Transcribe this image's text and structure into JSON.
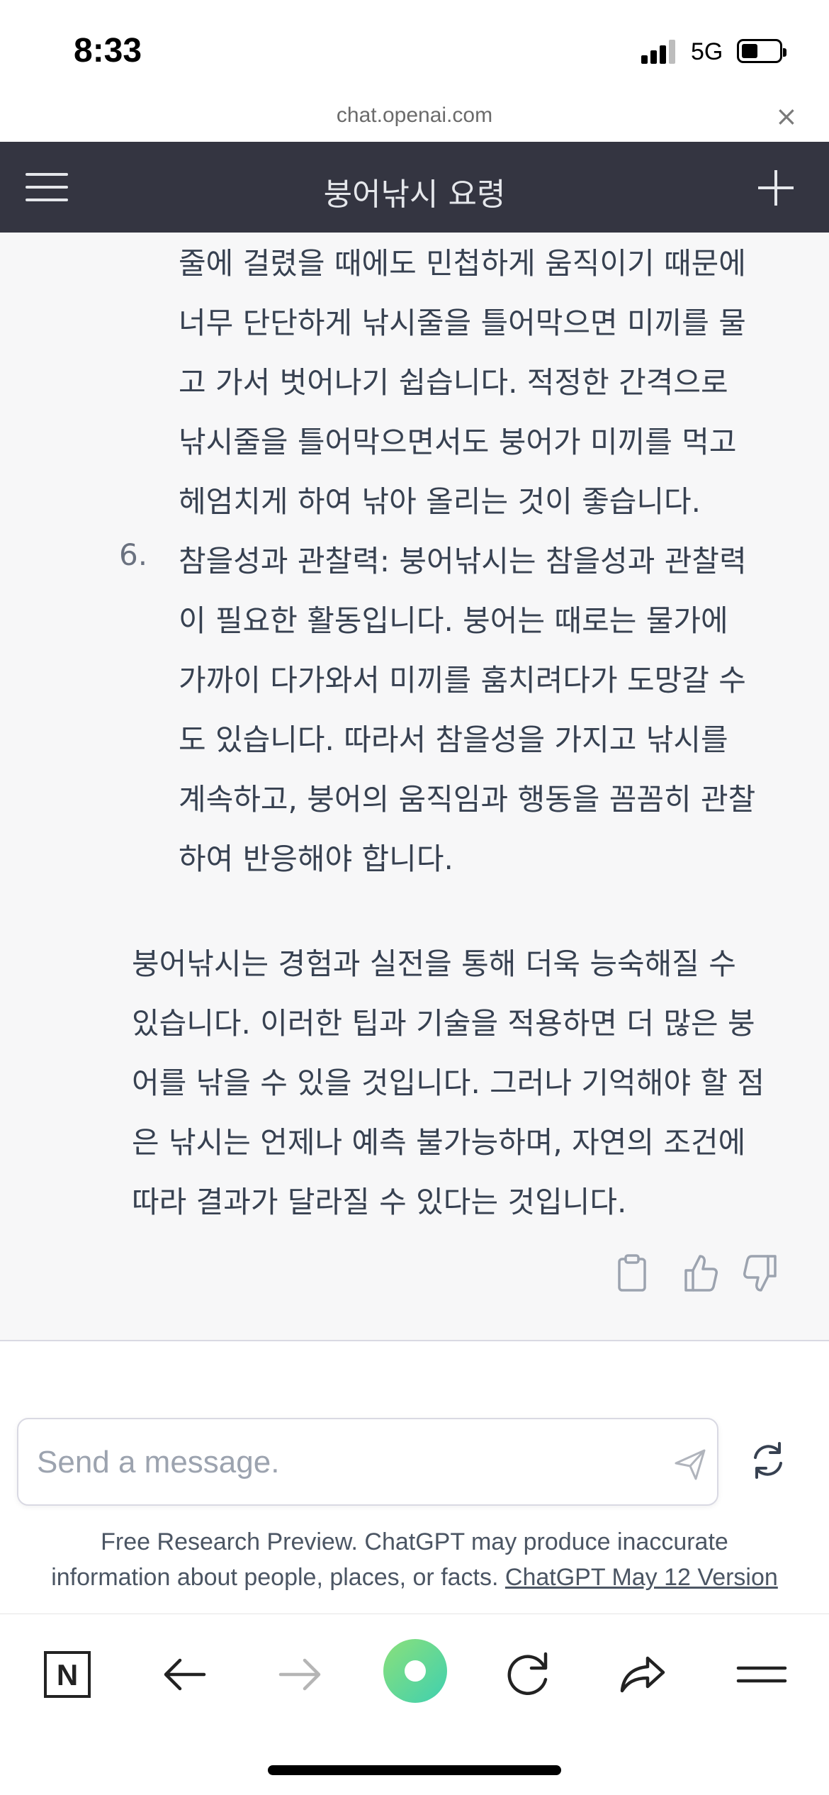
{
  "status_bar": {
    "time": "8:33",
    "network": "5G"
  },
  "browser": {
    "url": "chat.openai.com",
    "close_glyph": "×"
  },
  "header": {
    "menu_icon": "hamburger-menu-icon",
    "title": "붕어낚시 요령",
    "new_chat_icon": "plus-icon"
  },
  "message": {
    "item5_continuation": [
      "줄에 걸렸을 때에도 민첩하게 움직이기 때문에",
      "너무 단단하게 낚시줄을 틀어막으면 미끼를 물",
      "고 가서 벗어나기 쉽습니다. 적정한 간격으로",
      "낚시줄을 틀어막으면서도 붕어가 미끼를 먹고",
      "헤엄치게 하여 낚아 올리는 것이 좋습니다."
    ],
    "item6": {
      "number": "6.",
      "lines": [
        "참을성과 관찰력: 붕어낚시는 참을성과 관찰력",
        "이 필요한 활동입니다. 붕어는 때로는 물가에",
        "가까이 다가와서 미끼를 훔치려다가 도망갈 수",
        "도 있습니다. 따라서 참을성을 가지고 낚시를",
        "계속하고, 붕어의 움직임과 행동을 꼼꼼히 관찰",
        "하여 반응해야 합니다."
      ]
    },
    "conclusion": [
      "붕어낚시는 경험과 실전을 통해 더욱 능숙해질 수",
      "있습니다. 이러한 팁과 기술을 적용하면 더 많은 붕",
      "어를 낚을 수 있을 것입니다. 그러나 기억해야 할 점",
      "은 낚시는 언제나 예측 불가능하며, 자연의 조건에",
      "따라 결과가 달라질 수 있다는 것입니다."
    ],
    "action_icons": [
      "clipboard-icon",
      "thumbs-up-icon",
      "thumbs-down-icon"
    ]
  },
  "composer": {
    "placeholder": "Send a message.",
    "send_icon": "send-icon",
    "regenerate_icon": "regenerate-icon"
  },
  "disclaimer": {
    "line1": "Free Research Preview. ChatGPT may produce inaccurate",
    "line2_text": "information about people, places, or facts. ",
    "version_link": "ChatGPT May 12 Version"
  },
  "bottom_toolbar": {
    "icons": [
      "n-logo-icon",
      "back-arrow-icon",
      "forward-arrow-icon",
      "home-circle-icon",
      "reload-icon",
      "share-icon",
      "menu-icon"
    ],
    "n_letter": "N"
  },
  "colors": {
    "header_bg": "#343541",
    "message_bg": "#f7f7f8",
    "accent_green": "#5ee0a0"
  }
}
